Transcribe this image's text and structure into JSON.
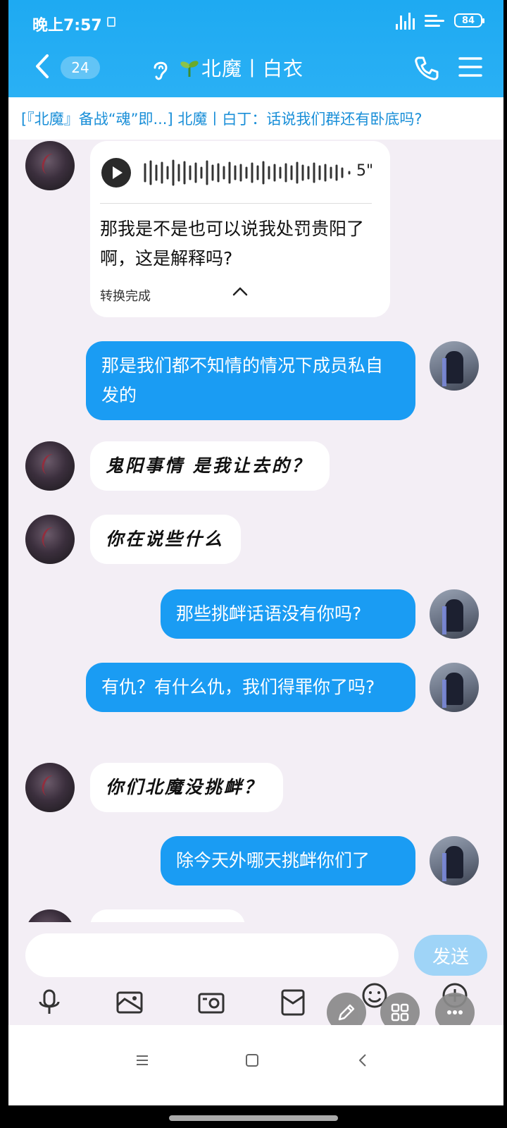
{
  "status_bar": {
    "time": "晚上7:57",
    "battery": "84"
  },
  "header": {
    "unread_count": "24",
    "title": "北魔丨白衣",
    "accent_color": "#1eaaf2"
  },
  "notice": {
    "text": "[『北魔』备战“魂”即...] 北魔丨白丁：话说我们群还有卧底吗?"
  },
  "voice_message": {
    "duration": "5\"",
    "transcript": "那我是不是也可以说我处罚贵阳了啊，这是解释吗?",
    "convert_status": "转换完成"
  },
  "messages": [
    {
      "side": "out",
      "text": "那是我们都不知情的情况下成员私自发的"
    },
    {
      "side": "in",
      "text": "鬼阳事情 是我让去的？"
    },
    {
      "side": "in",
      "text": "你在说些什么"
    },
    {
      "side": "out",
      "text": "那些挑衅话语没有你吗?"
    },
    {
      "side": "out",
      "text": "有仇？有什么仇，我们得罪你了吗?"
    },
    {
      "side": "in",
      "text": "你们北魔没挑衅？"
    },
    {
      "side": "out",
      "text": "除今天外哪天挑衅你们了"
    }
  ],
  "input": {
    "send_label": "发送"
  },
  "toolbar": {
    "icons": [
      "microphone-icon",
      "image-icon",
      "camera-icon",
      "red-packet-icon",
      "emoji-icon",
      "plus-icon"
    ]
  },
  "colors": {
    "out_bubble": "#1a9cf3",
    "in_bubble": "#ffffff",
    "background": "#f3eef5"
  }
}
